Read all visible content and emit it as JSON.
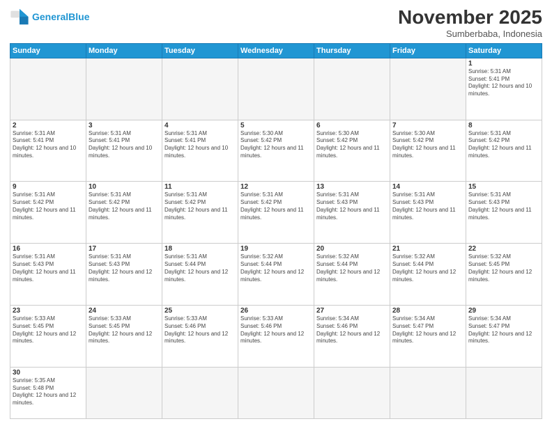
{
  "header": {
    "logo_general": "General",
    "logo_blue": "Blue",
    "month_title": "November 2025",
    "subtitle": "Sumberbaba, Indonesia"
  },
  "days_of_week": [
    "Sunday",
    "Monday",
    "Tuesday",
    "Wednesday",
    "Thursday",
    "Friday",
    "Saturday"
  ],
  "weeks": [
    [
      {
        "num": "",
        "info": "",
        "empty": true
      },
      {
        "num": "",
        "info": "",
        "empty": true
      },
      {
        "num": "",
        "info": "",
        "empty": true
      },
      {
        "num": "",
        "info": "",
        "empty": true
      },
      {
        "num": "",
        "info": "",
        "empty": true
      },
      {
        "num": "",
        "info": "",
        "empty": true
      },
      {
        "num": "1",
        "info": "Sunrise: 5:31 AM\nSunset: 5:41 PM\nDaylight: 12 hours and 10 minutes."
      }
    ],
    [
      {
        "num": "2",
        "info": "Sunrise: 5:31 AM\nSunset: 5:41 PM\nDaylight: 12 hours and 10 minutes."
      },
      {
        "num": "3",
        "info": "Sunrise: 5:31 AM\nSunset: 5:41 PM\nDaylight: 12 hours and 10 minutes."
      },
      {
        "num": "4",
        "info": "Sunrise: 5:31 AM\nSunset: 5:41 PM\nDaylight: 12 hours and 10 minutes."
      },
      {
        "num": "5",
        "info": "Sunrise: 5:30 AM\nSunset: 5:42 PM\nDaylight: 12 hours and 11 minutes."
      },
      {
        "num": "6",
        "info": "Sunrise: 5:30 AM\nSunset: 5:42 PM\nDaylight: 12 hours and 11 minutes."
      },
      {
        "num": "7",
        "info": "Sunrise: 5:30 AM\nSunset: 5:42 PM\nDaylight: 12 hours and 11 minutes."
      },
      {
        "num": "8",
        "info": "Sunrise: 5:31 AM\nSunset: 5:42 PM\nDaylight: 12 hours and 11 minutes."
      }
    ],
    [
      {
        "num": "9",
        "info": "Sunrise: 5:31 AM\nSunset: 5:42 PM\nDaylight: 12 hours and 11 minutes."
      },
      {
        "num": "10",
        "info": "Sunrise: 5:31 AM\nSunset: 5:42 PM\nDaylight: 12 hours and 11 minutes."
      },
      {
        "num": "11",
        "info": "Sunrise: 5:31 AM\nSunset: 5:42 PM\nDaylight: 12 hours and 11 minutes."
      },
      {
        "num": "12",
        "info": "Sunrise: 5:31 AM\nSunset: 5:42 PM\nDaylight: 12 hours and 11 minutes."
      },
      {
        "num": "13",
        "info": "Sunrise: 5:31 AM\nSunset: 5:43 PM\nDaylight: 12 hours and 11 minutes."
      },
      {
        "num": "14",
        "info": "Sunrise: 5:31 AM\nSunset: 5:43 PM\nDaylight: 12 hours and 11 minutes."
      },
      {
        "num": "15",
        "info": "Sunrise: 5:31 AM\nSunset: 5:43 PM\nDaylight: 12 hours and 11 minutes."
      }
    ],
    [
      {
        "num": "16",
        "info": "Sunrise: 5:31 AM\nSunset: 5:43 PM\nDaylight: 12 hours and 11 minutes."
      },
      {
        "num": "17",
        "info": "Sunrise: 5:31 AM\nSunset: 5:43 PM\nDaylight: 12 hours and 12 minutes."
      },
      {
        "num": "18",
        "info": "Sunrise: 5:31 AM\nSunset: 5:44 PM\nDaylight: 12 hours and 12 minutes."
      },
      {
        "num": "19",
        "info": "Sunrise: 5:32 AM\nSunset: 5:44 PM\nDaylight: 12 hours and 12 minutes."
      },
      {
        "num": "20",
        "info": "Sunrise: 5:32 AM\nSunset: 5:44 PM\nDaylight: 12 hours and 12 minutes."
      },
      {
        "num": "21",
        "info": "Sunrise: 5:32 AM\nSunset: 5:44 PM\nDaylight: 12 hours and 12 minutes."
      },
      {
        "num": "22",
        "info": "Sunrise: 5:32 AM\nSunset: 5:45 PM\nDaylight: 12 hours and 12 minutes."
      }
    ],
    [
      {
        "num": "23",
        "info": "Sunrise: 5:33 AM\nSunset: 5:45 PM\nDaylight: 12 hours and 12 minutes."
      },
      {
        "num": "24",
        "info": "Sunrise: 5:33 AM\nSunset: 5:45 PM\nDaylight: 12 hours and 12 minutes."
      },
      {
        "num": "25",
        "info": "Sunrise: 5:33 AM\nSunset: 5:46 PM\nDaylight: 12 hours and 12 minutes."
      },
      {
        "num": "26",
        "info": "Sunrise: 5:33 AM\nSunset: 5:46 PM\nDaylight: 12 hours and 12 minutes."
      },
      {
        "num": "27",
        "info": "Sunrise: 5:34 AM\nSunset: 5:46 PM\nDaylight: 12 hours and 12 minutes."
      },
      {
        "num": "28",
        "info": "Sunrise: 5:34 AM\nSunset: 5:47 PM\nDaylight: 12 hours and 12 minutes."
      },
      {
        "num": "29",
        "info": "Sunrise: 5:34 AM\nSunset: 5:47 PM\nDaylight: 12 hours and 12 minutes."
      }
    ],
    [
      {
        "num": "30",
        "info": "Sunrise: 5:35 AM\nSunset: 5:48 PM\nDaylight: 12 hours and 12 minutes."
      },
      {
        "num": "",
        "info": "",
        "empty": true
      },
      {
        "num": "",
        "info": "",
        "empty": true
      },
      {
        "num": "",
        "info": "",
        "empty": true
      },
      {
        "num": "",
        "info": "",
        "empty": true
      },
      {
        "num": "",
        "info": "",
        "empty": true
      },
      {
        "num": "",
        "info": "",
        "empty": true
      }
    ]
  ]
}
